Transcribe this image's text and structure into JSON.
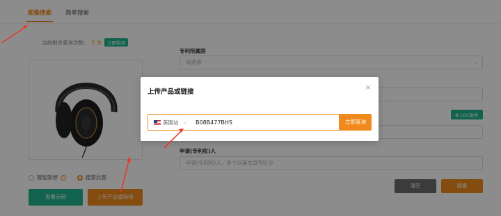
{
  "tabs": [
    {
      "label": "图像搜索"
    },
    {
      "label": "简单搜索"
    }
  ],
  "quota": {
    "label": "当前剩余查询次数：",
    "count": "5 次",
    "buy": "立即购买"
  },
  "left": {
    "radio_smart": "智能联想",
    "radio_image": "搜索此图",
    "btn_example": "查看示例",
    "btn_upload": "上传产品或链接"
  },
  "form": {
    "country_label": "专利所属国",
    "country_placeholder": "请选择",
    "loc_button": "LOC助手",
    "applicant_label": "申请(专利权)人",
    "applicant_placeholder": "申请(专利权)人，多个以英文逗号区分",
    "clear": "清空",
    "search": "搜索"
  },
  "modal": {
    "title": "上传产品或链接",
    "close": "×",
    "site": "美国站",
    "asin": "B08B477BHS",
    "query": "立即查询"
  },
  "colors": {
    "accent": "#f08a1c",
    "green": "#1fb58f",
    "arrow": "#e53b2c"
  }
}
